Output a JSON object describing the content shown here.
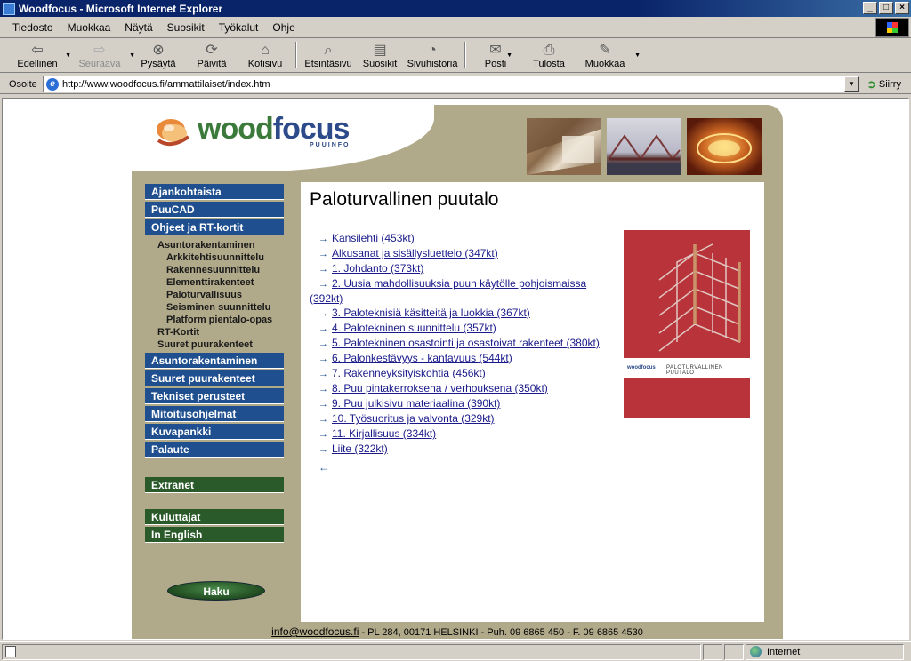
{
  "window": {
    "title": "Woodfocus - Microsoft Internet Explorer",
    "controls": [
      "_",
      "□",
      "×"
    ]
  },
  "menu": [
    "Tiedosto",
    "Muokkaa",
    "Näytä",
    "Suosikit",
    "Työkalut",
    "Ohje"
  ],
  "toolbar": {
    "back": "Edellinen",
    "forward": "Seuraava",
    "stop": "Pysäytä",
    "refresh": "Päivitä",
    "home": "Kotisivu",
    "search": "Etsintäsivu",
    "favorites": "Suosikit",
    "history": "Sivuhistoria",
    "mail": "Posti",
    "print": "Tulosta",
    "edit": "Muokkaa"
  },
  "address": {
    "label": "Osoite",
    "url": "http://www.woodfocus.fi/ammattilaiset/index.htm",
    "go": "Siirry"
  },
  "site": {
    "logo_word1": "wood",
    "logo_word2": "focus",
    "logo_sub": "PUUINFO",
    "nav_top": [
      "Ajankohtaista",
      "PuuCAD",
      "Ohjeet ja RT-kortit"
    ],
    "subnav": {
      "group": "Asuntorakentaminen",
      "items": [
        "Arkkitehtisuunnittelu",
        "Rakennesuunnittelu",
        "Elementtirakenteet",
        "Paloturvallisuus",
        "Seisminen suunnittelu",
        "Platform pientalo-opas"
      ],
      "after": [
        "RT-Kortit",
        "Suuret puurakenteet"
      ]
    },
    "nav_bottom": [
      "Asuntorakentaminen",
      "Suuret puurakenteet",
      "Tekniset perusteet",
      "Mitoitusohjelmat",
      "Kuvapankki",
      "Palaute"
    ],
    "extranet": "Extranet",
    "nav_green": [
      "Kuluttajat",
      "In English"
    ],
    "search_button": "Haku",
    "page_title": "Paloturvallinen puutalo",
    "links": [
      "Kansilehti (453kt)",
      "Alkusanat ja sisällysluettelo (347kt)",
      "1. Johdanto (373kt)",
      "2. Uusia mahdollisuuksia puun käytölle pohjoismaissa",
      "3. Paloteknisiä käsitteitä ja luokkia (367kt)",
      "4. Palotekninen suunnittelu (357kt)",
      "5. Palotekninen osastointi ja osastoivat rakenteet (380kt)",
      "6. Palonkestävyys - kantavuus (544kt)",
      "7. Rakenneyksityiskohtia (456kt)",
      "8. Puu pintakerroksena / verhouksena (350kt)",
      "9. Puu julkisivu materiaalina (390kt)",
      "10. Työsuoritus ja valvonta (329kt)",
      "11. Kirjallisuus (334kt)",
      "Liite (322kt)"
    ],
    "link2_cont": "(392kt)",
    "back_arrow": "←",
    "cover": {
      "brand": "woodfocus",
      "title": "PALOTURVALLINEN PUUTALO"
    },
    "footer": {
      "email": "info@woodfocus.fi",
      "text": " - PL 284, 00171 HELSINKI - Puh. 09 6865 450 - F. 09 6865 4530"
    }
  },
  "status": {
    "zone": "Internet"
  }
}
